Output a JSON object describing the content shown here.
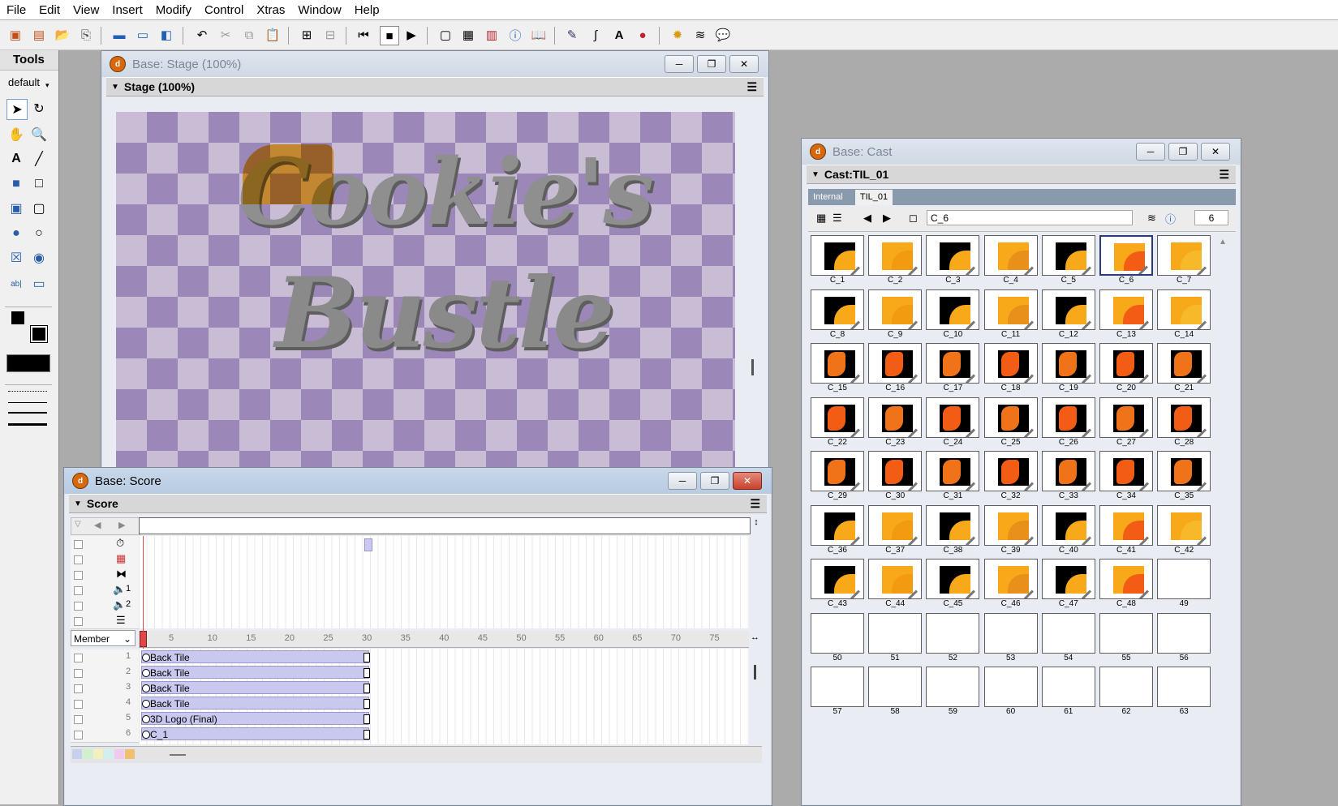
{
  "menu": [
    "File",
    "Edit",
    "View",
    "Insert",
    "Modify",
    "Control",
    "Xtras",
    "Window",
    "Help"
  ],
  "tools_panel": {
    "title": "Tools",
    "preset": "default"
  },
  "stage_window": {
    "title": "Base: Stage (100%)",
    "panel_title": "Stage (100%)",
    "logo_line1": "Cookie's",
    "logo_line2": "Bustle"
  },
  "score_window": {
    "title": "Base: Score",
    "panel_title": "Score",
    "display_mode": "Member",
    "ruler_ticks": [
      "5",
      "10",
      "15",
      "20",
      "25",
      "30",
      "35",
      "40",
      "45",
      "50",
      "55",
      "60",
      "65",
      "70",
      "75"
    ],
    "sound_channels": [
      "1",
      "2"
    ],
    "sprite_channels": [
      {
        "num": "1",
        "label": "Back Tile"
      },
      {
        "num": "2",
        "label": "Back Tile"
      },
      {
        "num": "3",
        "label": "Back Tile"
      },
      {
        "num": "4",
        "label": "Back Tile"
      },
      {
        "num": "5",
        "label": "3D Logo (Final)"
      },
      {
        "num": "6",
        "label": "C_1"
      }
    ]
  },
  "cast_window": {
    "title": "Base: Cast",
    "panel_title": "Cast:TIL_01",
    "tabs": [
      "Internal",
      "TIL_01"
    ],
    "member_name": "C_6",
    "member_number": "6",
    "members": [
      "C_1",
      "C_2",
      "C_3",
      "C_4",
      "C_5",
      "C_6",
      "C_7",
      "C_8",
      "C_9",
      "C_10",
      "C_11",
      "C_12",
      "C_13",
      "C_14",
      "C_15",
      "C_16",
      "C_17",
      "C_18",
      "C_19",
      "C_20",
      "C_21",
      "C_22",
      "C_23",
      "C_24",
      "C_25",
      "C_26",
      "C_27",
      "C_28",
      "C_29",
      "C_30",
      "C_31",
      "C_32",
      "C_33",
      "C_34",
      "C_35",
      "C_36",
      "C_37",
      "C_38",
      "C_39",
      "C_40",
      "C_41",
      "C_42",
      "C_43",
      "C_44",
      "C_45",
      "C_46",
      "C_47",
      "C_48",
      "49",
      "50",
      "51",
      "52",
      "53",
      "54",
      "55",
      "56",
      "57",
      "58",
      "59",
      "60",
      "61",
      "62",
      "63"
    ],
    "selected_member": "C_6"
  }
}
